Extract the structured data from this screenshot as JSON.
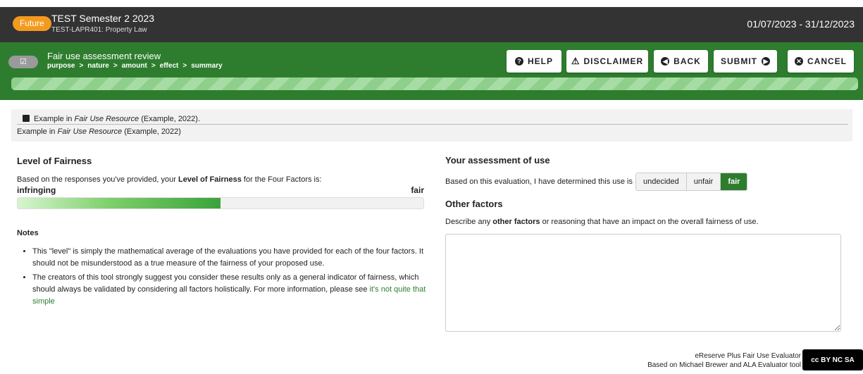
{
  "header": {
    "badge": "Future",
    "course_title": "TEST Semester 2 2023",
    "course_code": "TEST-LAPR401: Property Law",
    "date_range": "01/07/2023 - 31/12/2023"
  },
  "toolbar": {
    "title": "Fair use assessment review",
    "steps": [
      "purpose",
      "nature",
      "amount",
      "effect",
      "summary"
    ],
    "step_separator": ">",
    "buttons": {
      "help": "HELP",
      "disclaimer": "DISCLAIMER",
      "back": "BACK",
      "submit": "SUBMIT",
      "cancel": "CANCEL"
    }
  },
  "citation": {
    "line1_prefix": "Example in ",
    "line1_italic": "Fair Use Resource",
    "line1_suffix": " (Example, 2022).",
    "line2_prefix": "Example in ",
    "line2_italic": "Fair Use Resource",
    "line2_suffix": " (Example, 2022)"
  },
  "level": {
    "title": "Level of Fairness",
    "desc_prefix": "Based on the responses you've provided, your ",
    "desc_bold": "Level of Fairness",
    "desc_suffix": " for the Four Factors is:",
    "label_left": "infringing",
    "label_right": "fair",
    "value_fraction": 0.5
  },
  "notes": {
    "title": "Notes",
    "item1": "This \"level\" is simply the mathematical average of the evaluations you have provided for each of the four factors. It should not be misunderstood as a true measure of the fairness of your proposed use.",
    "item2_text": "The creators of this tool strongly suggest you consider these results only as a general indicator of fairness, which should always be validated by considering all factors holistically. For more information, please see ",
    "item2_link": "it's not quite that simple"
  },
  "assessment": {
    "title": "Your assessment of use",
    "prompt": "Based on this evaluation, I have determined this use is",
    "options": [
      "undecided",
      "unfair",
      "fair"
    ],
    "selected": "fair"
  },
  "other_factors": {
    "title": "Other factors",
    "desc_prefix": "Describe any ",
    "desc_bold": "other factors",
    "desc_suffix": " or reasoning that have an impact on the overall fairness of use.",
    "value": ""
  },
  "footer": {
    "line1": "eReserve Plus Fair Use Evaluator",
    "line2": "Based on Michael Brewer and ALA Evaluator tool",
    "license": "cc BY NC SA"
  },
  "colors": {
    "accent_green": "#2e7d2e",
    "future_badge": "#f39a1e",
    "topbar": "#333333"
  }
}
